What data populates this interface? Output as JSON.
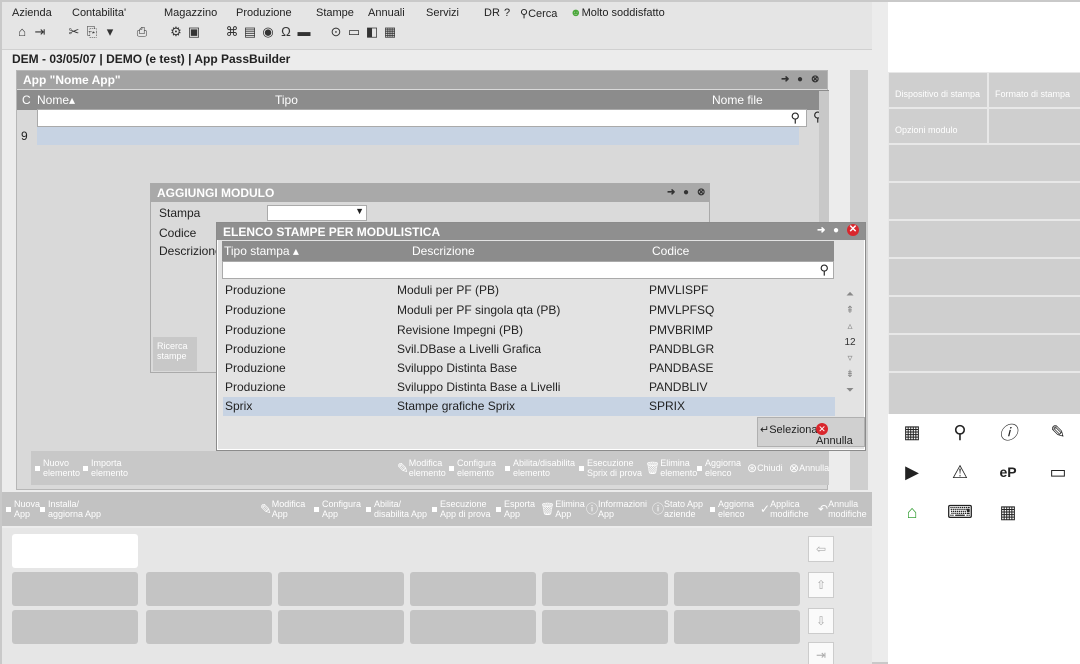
{
  "menu": {
    "items": [
      "Azienda",
      "Contabilita'",
      "Magazzino",
      "Produzione",
      "Stampe",
      "Annuali",
      "Servizi",
      "DR",
      "?"
    ],
    "search_label": "Cerca",
    "mood_label": "Molto soddisfatto"
  },
  "status": {
    "breadcrumb": "DEM - 03/05/07 | DEMO (e test) | App PassBuilder"
  },
  "main_window": {
    "title": "App \"Nome App\"",
    "col_code_short": "C",
    "col_name": "Nome",
    "col_type": "Tipo",
    "col_file": "Nome file",
    "row_value": "9"
  },
  "add_module": {
    "title": "AGGIUNGI MODULO",
    "label_stampa": "Stampa",
    "label_codice": "Codice",
    "label_descrizione": "Descrizione",
    "ricerca_stampe": "Ricerca stampe"
  },
  "elenco": {
    "title": "ELENCO STAMPE PER MODULISTICA",
    "headers": {
      "tipo": "Tipo stampa",
      "descrizione": "Descrizione",
      "codice": "Codice"
    },
    "rows": [
      {
        "tipo": "Produzione",
        "descrizione": "Moduli per PF (PB)",
        "codice": "PMVLISPF"
      },
      {
        "tipo": "Produzione",
        "descrizione": "Moduli per PF singola qta (PB)",
        "codice": "PMVLPFSQ"
      },
      {
        "tipo": "Produzione",
        "descrizione": "Revisione Impegni (PB)",
        "codice": "PMVBRIMP"
      },
      {
        "tipo": "Produzione",
        "descrizione": "Svil.DBase a Livelli Grafica",
        "codice": "PANDBLGR"
      },
      {
        "tipo": "Produzione",
        "descrizione": "Sviluppo Distinta Base",
        "codice": "PANDBASE"
      },
      {
        "tipo": "Produzione",
        "descrizione": "Sviluppo Distinta Base a Livelli",
        "codice": "PANDBLIV"
      },
      {
        "tipo": "Sprix",
        "descrizione": "Stampe grafiche Sprix",
        "codice": "SPRIX"
      }
    ],
    "page_number": "12",
    "btn_seleziona": "Seleziona",
    "btn_annulla": "Annulla"
  },
  "dialog_buttons": {
    "nuovo_elemento": "Nuovo elemento",
    "importa_elemento": "Importa elemento",
    "modifica_elemento": "Modifica elemento",
    "configura_elemento": "Configura elemento",
    "abilita_disabilita": "Abilita/disabilita elemento",
    "esecuzione_sprix": "Esecuzione Sprix di prova",
    "elimina_elemento": "Elimina elemento",
    "aggiorna_elenco": "Aggiorna elenco",
    "chiudi": "Chiudi",
    "annulla": "Annulla"
  },
  "app_buttons": {
    "nuova_app": "Nuova App",
    "installa": "Installa/ aggiorna App",
    "modifica_app": "Modifica App",
    "configura_app": "Configura App",
    "abilita_app": "Abilita/ disabilita App",
    "esecuzione_app": "Esecuzione App di prova",
    "esporta_app": "Esporta App",
    "elimina_app": "Elimina App",
    "informazioni_app": "Informazioni App",
    "stato_app": "Stato App aziende",
    "aggiorna_elenco": "Aggiorna elenco",
    "applica_modifiche": "Applica modifiche",
    "annulla_modifiche": "Annulla modifiche"
  },
  "right_panel": {
    "dispositivo": "Dispositivo di stampa",
    "formato": "Formato di stampa",
    "opzioni": "Opzioni modulo"
  }
}
